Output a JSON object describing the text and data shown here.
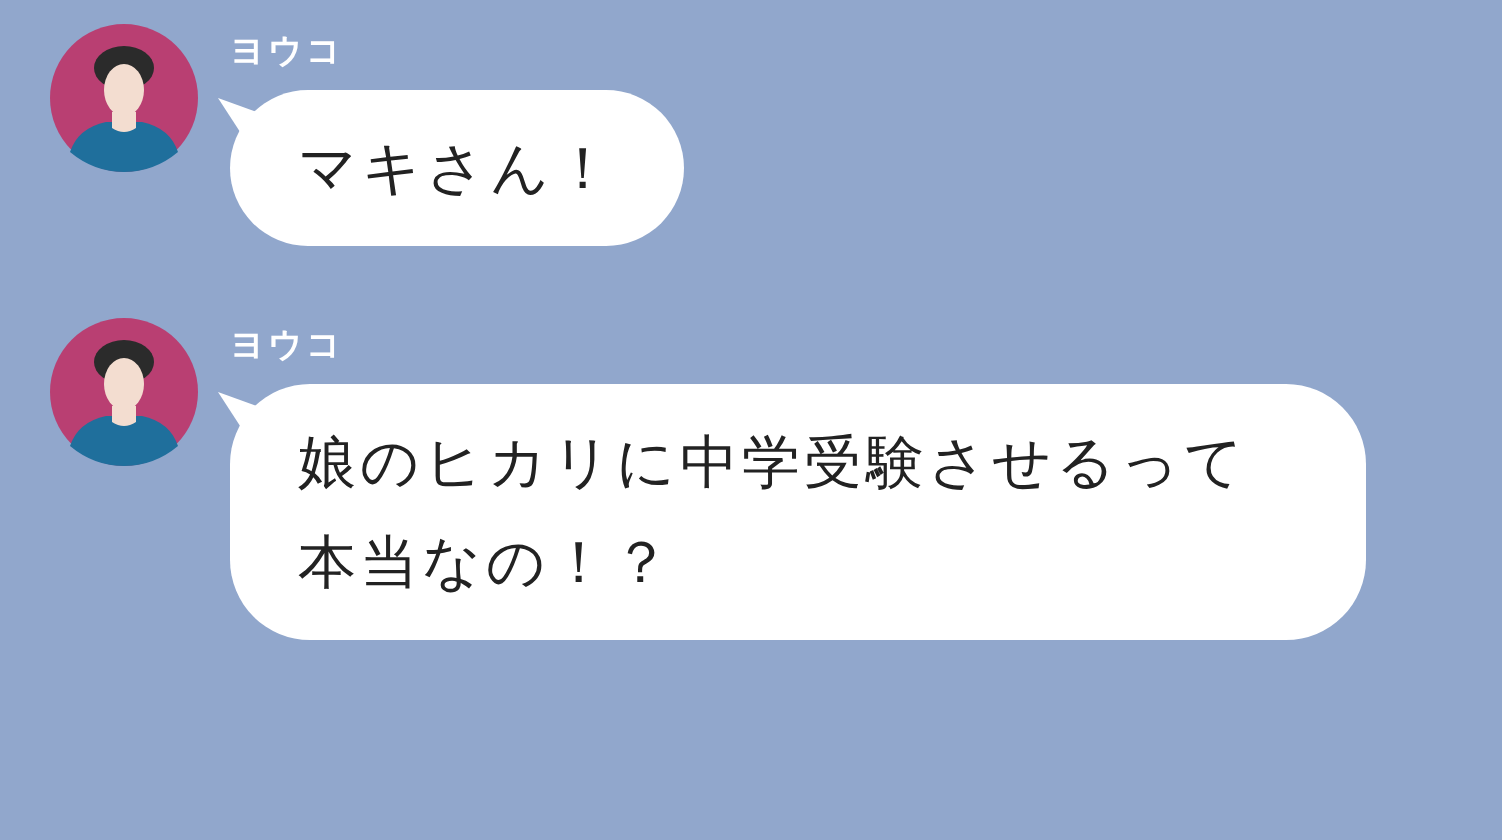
{
  "messages": [
    {
      "sender": "ヨウコ",
      "text": "マキさん！"
    },
    {
      "sender": "ヨウコ",
      "text": "娘のヒカリに中学受験させるって本当なの！？"
    }
  ]
}
